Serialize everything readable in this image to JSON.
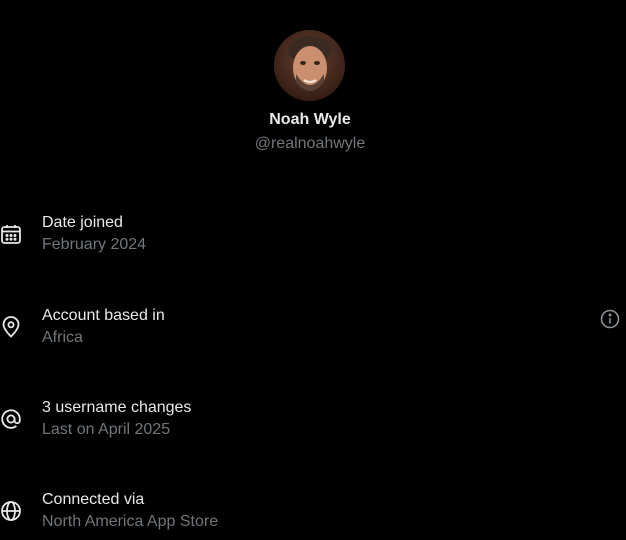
{
  "profile": {
    "name": "Noah Wyle",
    "handle": "@realnoahwyle"
  },
  "details": [
    {
      "icon": "calendar-icon",
      "title": "Date joined",
      "subtitle": "February 2024"
    },
    {
      "icon": "location-pin-icon",
      "title": "Account based in",
      "subtitle": "Africa",
      "action_icon": "info-icon"
    },
    {
      "icon": "at-sign-icon",
      "title": "3 username changes",
      "subtitle": "Last on April 2025"
    },
    {
      "icon": "globe-icon",
      "title": "Connected via",
      "subtitle": "North America App Store"
    }
  ],
  "colors": {
    "background": "#000000",
    "primary_text": "#e7e9ea",
    "secondary_text": "#71767b"
  }
}
